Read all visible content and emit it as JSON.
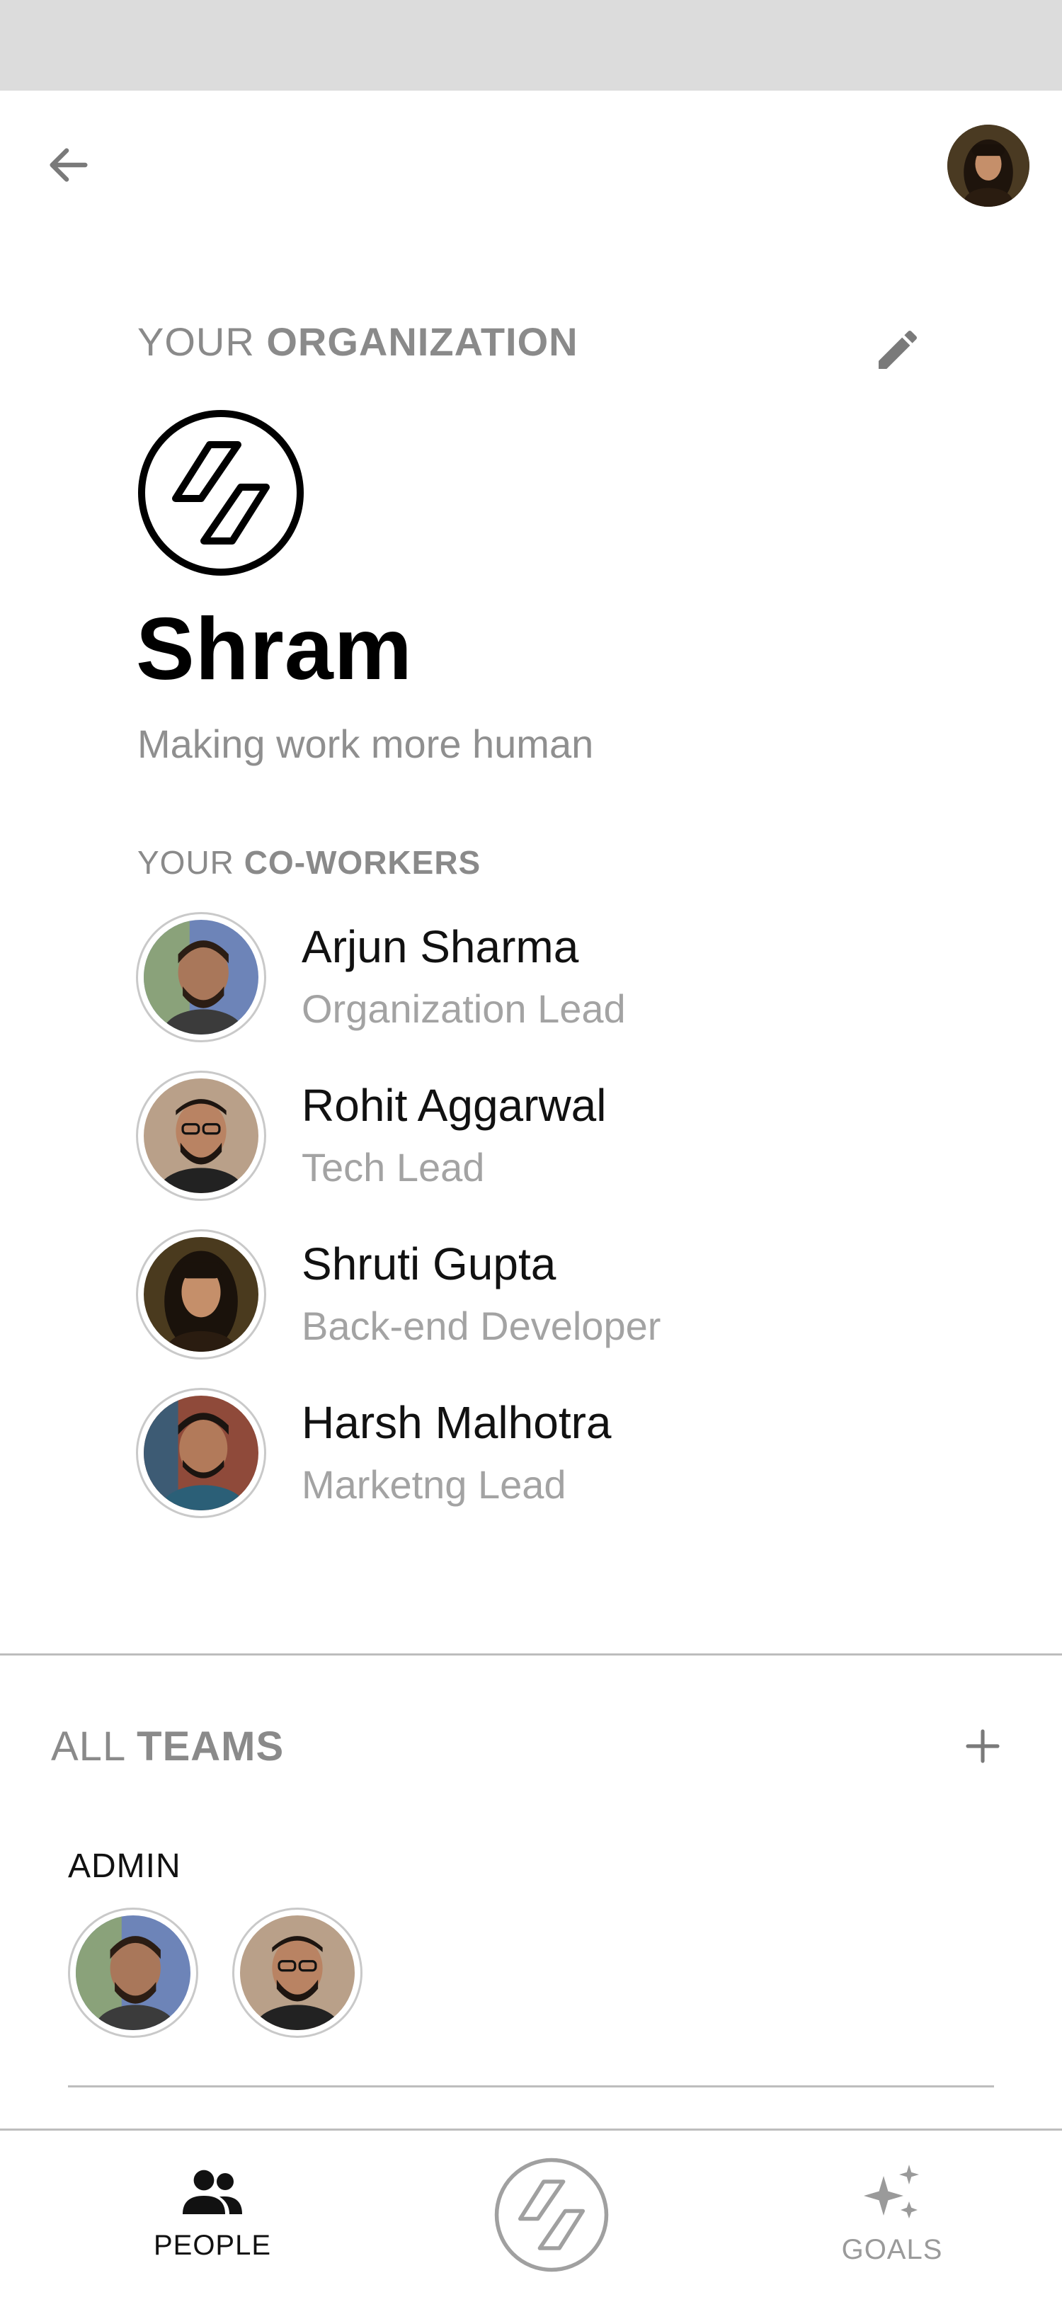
{
  "org_section": {
    "label_light": "YOUR ",
    "label_bold": "ORGANIZATION",
    "name": "Shram",
    "tagline": "Making work more human"
  },
  "coworkers_section": {
    "label_light": "YOUR ",
    "label_bold": "CO-WORKERS",
    "items": [
      {
        "name": "Arjun Sharma",
        "role": "Organization Lead"
      },
      {
        "name": "Rohit Aggarwal",
        "role": "Tech Lead"
      },
      {
        "name": "Shruti Gupta",
        "role": "Back-end Developer"
      },
      {
        "name": "Harsh Malhotra",
        "role": "Marketng Lead"
      }
    ]
  },
  "teams_section": {
    "label_light": "ALL ",
    "label_bold": "TEAMS",
    "teams": [
      {
        "name": "ADMIN"
      }
    ]
  },
  "bottom_nav": {
    "people_label": "PEOPLE",
    "goals_label": "GOALS"
  },
  "colors": {
    "status_bar": "#dcdcdc",
    "muted_text": "#8a8a8a",
    "divider": "#bdbdbd"
  },
  "icons": [
    "back-arrow-icon",
    "edit-pencil-icon",
    "shram-logo-icon",
    "plus-icon",
    "people-icon",
    "sparkle-icon"
  ]
}
